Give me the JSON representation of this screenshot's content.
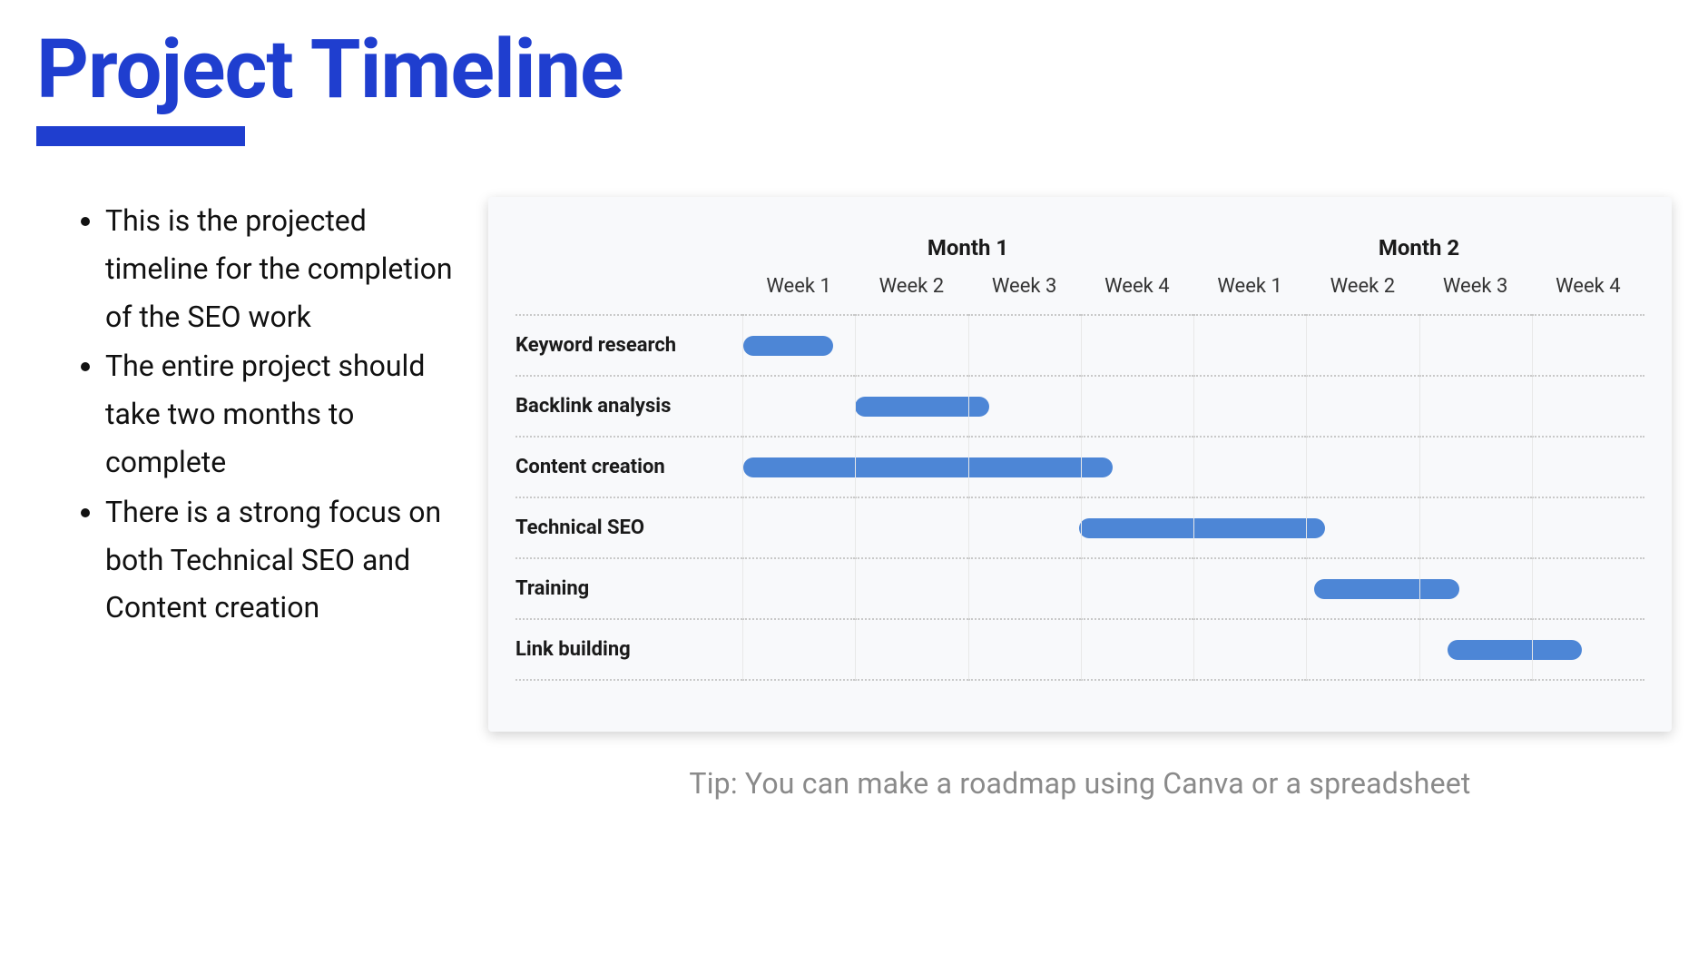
{
  "title": "Project Timeline",
  "bullets": [
    "This is the projected timeline for the completion of the SEO work",
    "The entire project should take two months to complete",
    "There is a strong focus on both Technical SEO and Content creation"
  ],
  "tip": "Tip: You can make a roadmap using Canva or a spreadsheet",
  "colors": {
    "accent": "#1f3ecf",
    "bar": "#4d86d6"
  },
  "chart_data": {
    "type": "bar",
    "title": "Project Timeline",
    "xlabel": "",
    "ylabel": "",
    "months": [
      "Month 1",
      "Month 2"
    ],
    "weeks": [
      "Week 1",
      "Week 2",
      "Week 3",
      "Week 4",
      "Week 1",
      "Week 2",
      "Week 3",
      "Week 4"
    ],
    "tasks": [
      {
        "name": "Keyword research",
        "start": 1,
        "end": 1.8
      },
      {
        "name": "Backlink analysis",
        "start": 2,
        "end": 3.2
      },
      {
        "name": "Content creation",
        "start": 1,
        "end": 4.3
      },
      {
        "name": "Technical SEO",
        "start": 4,
        "end": 6.2
      },
      {
        "name": "Training",
        "start": 6.1,
        "end": 7.4
      },
      {
        "name": "Link building",
        "start": 7.3,
        "end": 8.5
      }
    ],
    "xlim": [
      1,
      9
    ]
  }
}
